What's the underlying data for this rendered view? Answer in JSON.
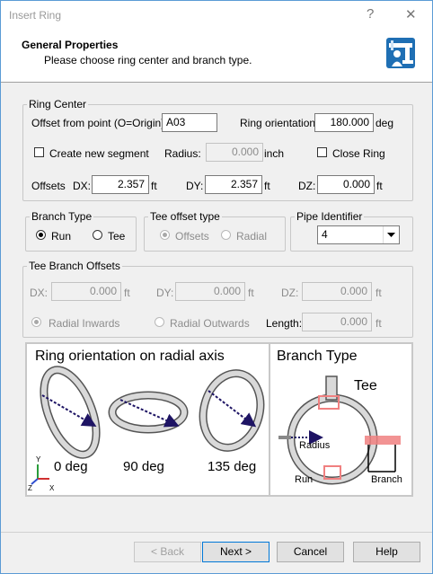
{
  "window": {
    "title": "Insert Ring",
    "help_glyph": "?",
    "close_glyph": "✕"
  },
  "header": {
    "title": "General Properties",
    "subtitle": "Please choose ring center and branch type."
  },
  "ring_center": {
    "legend": "Ring Center",
    "offset_label": "Offset from point (O=Origin):",
    "offset_value": "A03",
    "orientation_label": "Ring orientation:",
    "orientation_value": "180.000",
    "orientation_unit": "deg",
    "create_new_segment": "Create new segment",
    "create_new_segment_checked": false,
    "radius_label": "Radius:",
    "radius_value": "0.000",
    "radius_unit": "inch",
    "close_ring": "Close Ring",
    "close_ring_checked": false,
    "offsets_label": "Offsets",
    "dx_label": "DX:",
    "dx_value": "2.357",
    "dx_unit": "ft",
    "dy_label": "DY:",
    "dy_value": "2.357",
    "dy_unit": "ft",
    "dz_label": "DZ:",
    "dz_value": "0.000",
    "dz_unit": "ft"
  },
  "branch_type": {
    "legend": "Branch Type",
    "run": "Run",
    "tee": "Tee",
    "selected": "Run"
  },
  "tee_offset_type": {
    "legend": "Tee offset type",
    "offsets": "Offsets",
    "radial": "Radial",
    "selected": "Offsets"
  },
  "pipe_identifier": {
    "legend": "Pipe Identifier",
    "value": "4"
  },
  "tee_branch_offsets": {
    "legend": "Tee Branch Offsets",
    "dx_label": "DX:",
    "dx_value": "0.000",
    "dx_unit": "ft",
    "dy_label": "DY:",
    "dy_value": "0.000",
    "dy_unit": "ft",
    "dz_label": "DZ:",
    "dz_value": "0.000",
    "dz_unit": "ft",
    "radial_inwards": "Radial Inwards",
    "radial_outwards": "Radial Outwards",
    "selected": "Radial Inwards",
    "length_label": "Length:",
    "length_value": "0.000",
    "length_unit": "ft"
  },
  "diagram": {
    "orientation_title": "Ring orientation on radial axis",
    "angle_0": "0 deg",
    "angle_90": "90 deg",
    "angle_135": "135 deg",
    "axis_y": "Y",
    "axis_z": "Z",
    "axis_x": "X",
    "branch_title": "Branch Type",
    "tee_label": "Tee",
    "radius_label": "Radius",
    "run_label": "Run",
    "branch_label": "Branch"
  },
  "buttons": {
    "back": "< Back",
    "next": "Next >",
    "cancel": "Cancel",
    "help": "Help"
  },
  "colors": {
    "highlight": "#f08080",
    "arrow": "#1e1464",
    "window_border": "#5b9bd5"
  }
}
